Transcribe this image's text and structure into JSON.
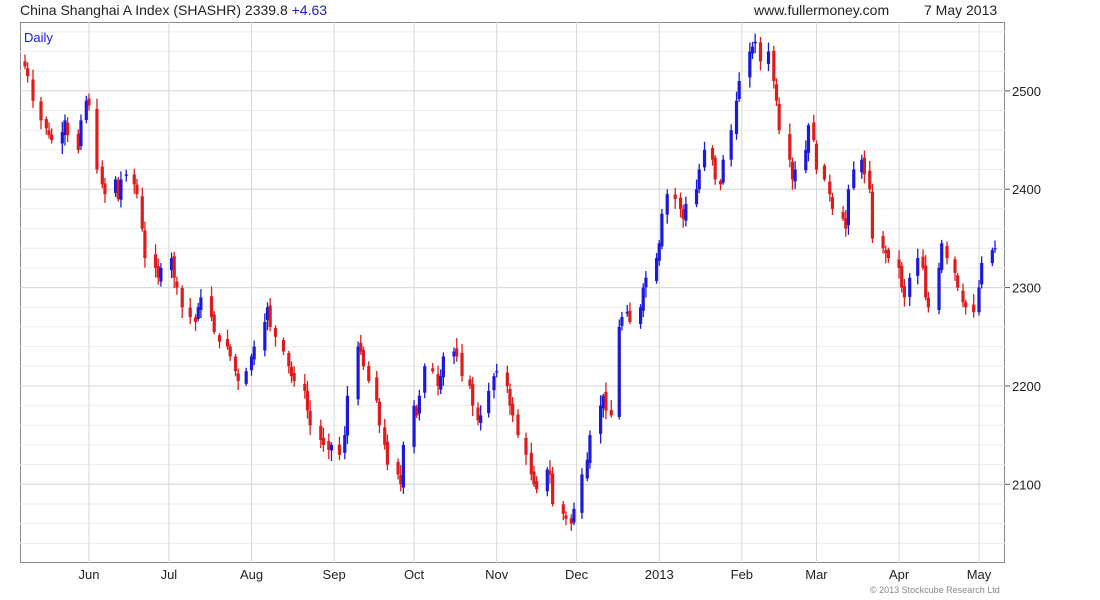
{
  "header": {
    "index_name": "China Shanghai A Index (SHASHR)",
    "last_value": "2339.8",
    "change": "+4.63",
    "website": "www.fullermoney.com",
    "date": "7 May 2013"
  },
  "period_label": "Daily",
  "copyright": "© 2013 Stockcube Research Ltd",
  "colors": {
    "up": "#1a1adb",
    "down": "#e01b1b",
    "grid": "#d7d7d7",
    "frame": "#8a8a8a"
  },
  "chart_data": {
    "type": "ohlc",
    "title": "China Shanghai A Index (SHASHR)",
    "frequency": "Daily",
    "ylim": [
      2020,
      2570
    ],
    "y_ticks": [
      2100,
      2200,
      2300,
      2400,
      2500
    ],
    "x_tick_labels": [
      "Jun",
      "Jul",
      "Aug",
      "Sep",
      "Oct",
      "Nov",
      "Dec",
      "2013",
      "Feb",
      "Mar",
      "Apr",
      "May"
    ],
    "y_axis_position": "right",
    "grid": true,
    "start_date": "2012-05-08",
    "end_date": "2013-05-07",
    "series": [
      {
        "values_close_approx": [
          2525,
          2515,
          2490,
          2470,
          2462,
          2455,
          2450,
          2458,
          2470,
          2455,
          2440,
          2470,
          2490,
          2485,
          2420,
          2405,
          2395,
          2410,
          2390,
          2410,
          2415,
          2405,
          2395,
          2360,
          2330,
          2320,
          2310,
          2320,
          2330,
          2310,
          2300,
          2280,
          2270,
          2265,
          2280,
          2290,
          2270,
          2255,
          2245,
          2240,
          2230,
          2215,
          2205,
          2215,
          2230,
          2240,
          2265,
          2280,
          2260,
          2250,
          2235,
          2220,
          2210,
          2205,
          2195,
          2175,
          2160,
          2145,
          2140,
          2135,
          2140,
          2130,
          2150,
          2190,
          2240,
          2235,
          2220,
          2205,
          2185,
          2160,
          2140,
          2120,
          2110,
          2100,
          2140,
          2180,
          2170,
          2190,
          2220,
          2215,
          2200,
          2210,
          2230,
          2235,
          2230,
          2210,
          2200,
          2180,
          2165,
          2170,
          2195,
          2210,
          2215,
          2200,
          2180,
          2170,
          2150,
          2130,
          2110,
          2100,
          2095,
          2115,
          2110,
          2080,
          2070,
          2065,
          2060,
          2075,
          2110,
          2125,
          2150,
          2180,
          2190,
          2175,
          2170,
          2260,
          2270,
          2275,
          2265,
          2280,
          2300,
          2310,
          2330,
          2345,
          2375,
          2395,
          2390,
          2380,
          2370,
          2385,
          2400,
          2420,
          2440,
          2430,
          2410,
          2405,
          2430,
          2460,
          2490,
          2510,
          2540,
          2545,
          2550,
          2530,
          2540,
          2510,
          2490,
          2460,
          2430,
          2410,
          2420,
          2440,
          2465,
          2450,
          2420,
          2410,
          2395,
          2380,
          2370,
          2360,
          2400,
          2420,
          2430,
          2415,
          2400,
          2350,
          2340,
          2335,
          2330,
          2320,
          2300,
          2290,
          2310,
          2330,
          2320,
          2290,
          2280,
          2320,
          2345,
          2330,
          2315,
          2300,
          2285,
          2280,
          2275,
          2300,
          2325,
          2338,
          2340
        ]
      }
    ]
  }
}
